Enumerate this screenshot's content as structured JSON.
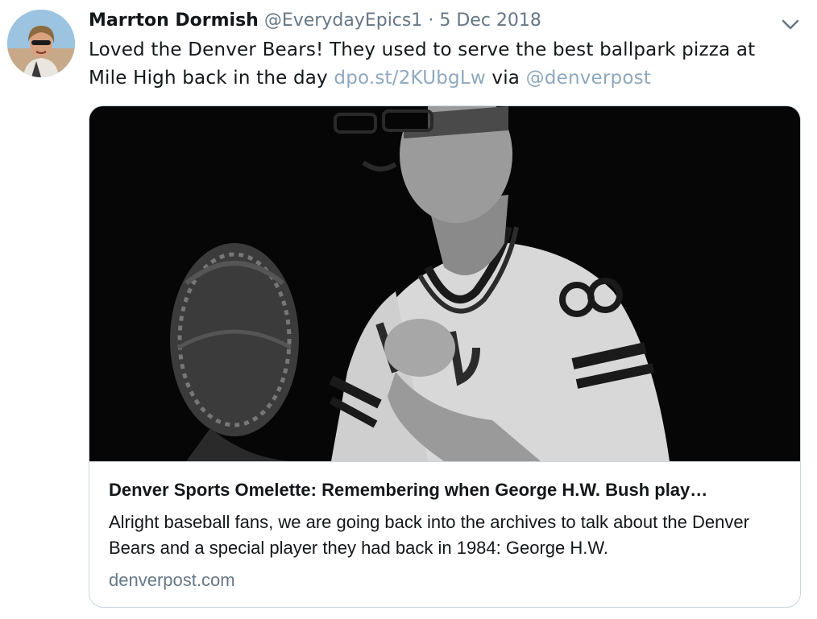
{
  "tweet": {
    "author_name": "Marrton Dormish",
    "handle": "@EverydayEpics1",
    "separator": "·",
    "date": "5 Dec 2018",
    "menu_icon": "chevron-down-icon",
    "text_before_link": "Loved the Denver Bears! They used to serve the best ballpark pizza at Mile High back in the day ",
    "link_text": "dpo.st/2KUbgLw",
    "text_via": " via ",
    "mention": "@denverpost"
  },
  "card": {
    "title": "Denver Sports Omelette: Remembering when George H.W. Bush play…",
    "description": "Alright baseball fans, we are going back into the archives to talk about the Denver Bears and a special player they had back in 1984: George H.W.",
    "domain": "denverpost.com"
  },
  "colors": {
    "text": "#14171a",
    "secondary": "#657786",
    "link": "#8ea8bd",
    "border": "#ccd6dd"
  }
}
